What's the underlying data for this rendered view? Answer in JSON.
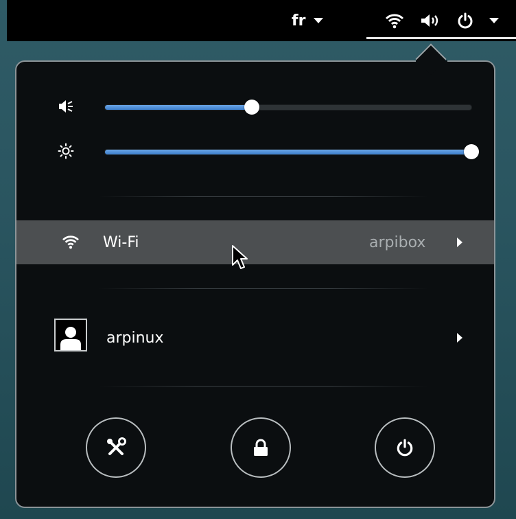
{
  "top_bar": {
    "language": "fr",
    "icons": [
      "wifi-icon",
      "volume-icon",
      "power-icon",
      "chevron-down-icon"
    ]
  },
  "menu": {
    "volume": {
      "icon": "volume-icon",
      "level": 0.4
    },
    "brightness": {
      "icon": "brightness-icon",
      "level": 1.0
    },
    "wifi": {
      "icon": "wifi-icon",
      "label": "Wi-Fi",
      "network": "arpibox"
    },
    "user": {
      "icon": "avatar",
      "label": "arpinux"
    },
    "buttons": [
      {
        "icon": "settings-icon"
      },
      {
        "icon": "lock-icon"
      },
      {
        "icon": "power-icon"
      }
    ]
  },
  "colors": {
    "slider_fill": "#4a8fdc",
    "highlight_row": "#4c4f51",
    "menu_bg": "#0b0e10"
  }
}
